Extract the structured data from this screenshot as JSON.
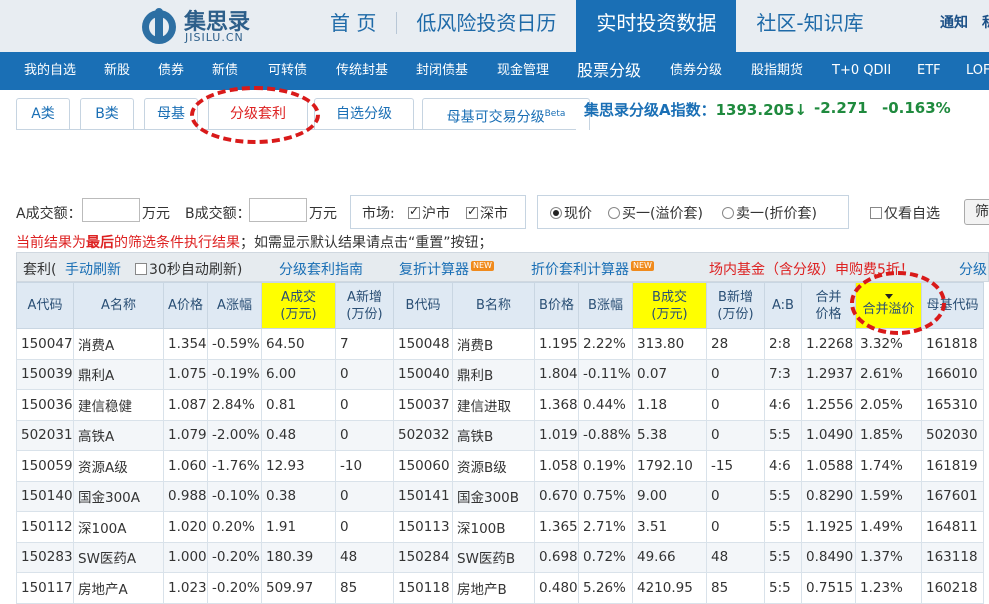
{
  "header": {
    "logo_cn": "集思录",
    "logo_en": "JISILU.CN",
    "nav": [
      {
        "label": "首 页",
        "active": false
      },
      {
        "label": "低风险投资日历",
        "active": false
      },
      {
        "label": "实时投资数据",
        "active": true
      },
      {
        "label": "社区-知识库",
        "active": false
      }
    ],
    "links": [
      "通知",
      "私"
    ]
  },
  "subnav": [
    "我的自选",
    "新股",
    "债券",
    "新债",
    "可转债",
    "传统封基",
    "封闭债基",
    "现金管理",
    "股票分级",
    "债券分级",
    "股指期货",
    "T+0 QDII",
    "ETF",
    "LOF"
  ],
  "tabs": [
    {
      "label": "A类"
    },
    {
      "label": "B类"
    },
    {
      "label": "母基"
    },
    {
      "label": "分级套利",
      "active": true
    },
    {
      "label": "自选分级"
    },
    {
      "label": "母基可交易分级",
      "sup": "Beta"
    }
  ],
  "index": {
    "label": "集思录分级A指数：",
    "value": "1393.205↓",
    "change": "-2.271",
    "pct": "-0.163%"
  },
  "filters": {
    "a_vol_label": "A成交额：",
    "a_unit": "万元",
    "b_vol_label": "B成交额：",
    "b_unit": "万元",
    "market_label": "市场:",
    "market_sh": "沪市",
    "market_sz": "深市",
    "price_now": "现价",
    "price_buy1": "买一(溢价套)",
    "price_sell1": "卖一(折价套)",
    "only_fav": "仅看自选",
    "filter_button": "筛"
  },
  "notice": {
    "part1": "当前结果为",
    "bold": "最后",
    "part2": "的筛选条件执行结果",
    "part3": "；如需显示默认结果请点击“重置”按钮；"
  },
  "band": {
    "title": "套利(",
    "manual": "手动刷新",
    "auto": "30秒自动刷新)",
    "guide": "分级套利指南",
    "calc1": "复折计算器",
    "calc2": "折价套利计算器",
    "new_tag": "NEW",
    "promo": "场内基金（含分级）申购费5折！",
    "more": "分级"
  },
  "columns": [
    "A代码",
    "A名称",
    "A价格",
    "A涨幅",
    "A成交\n(万元)",
    "A新增\n(万份)",
    "B代码",
    "B名称",
    "B价格",
    "B涨幅",
    "B成交\n(万元)",
    "B新增\n(万份)",
    "A:B",
    "合并\n价格",
    "合并溢价",
    "母基代码"
  ],
  "rows": [
    [
      "150047",
      "消费A",
      "1.354",
      "-0.59%",
      "64.50",
      "7",
      "150048",
      "消费B",
      "1.195",
      "2.22%",
      "313.80",
      "28",
      "2:8",
      "1.2268",
      "3.32%",
      "161818"
    ],
    [
      "150039",
      "鼎利A",
      "1.075",
      "-0.19%",
      "6.00",
      "0",
      "150040",
      "鼎利B",
      "1.804",
      "-0.11%",
      "0.07",
      "0",
      "7:3",
      "1.2937",
      "2.61%",
      "166010"
    ],
    [
      "150036",
      "建信稳健",
      "1.087",
      "2.84%",
      "0.81",
      "0",
      "150037",
      "建信进取",
      "1.368",
      "0.44%",
      "1.18",
      "0",
      "4:6",
      "1.2556",
      "2.05%",
      "165310"
    ],
    [
      "502031",
      "高铁A",
      "1.079",
      "-2.00%",
      "0.48",
      "0",
      "502032",
      "高铁B",
      "1.019",
      "-0.88%",
      "5.38",
      "0",
      "5:5",
      "1.0490",
      "1.85%",
      "502030"
    ],
    [
      "150059",
      "资源A级",
      "1.060",
      "-1.76%",
      "12.93",
      "-10",
      "150060",
      "资源B级",
      "1.058",
      "0.19%",
      "1792.10",
      "-15",
      "4:6",
      "1.0588",
      "1.74%",
      "161819"
    ],
    [
      "150140",
      "国金300A",
      "0.988",
      "-0.10%",
      "0.38",
      "0",
      "150141",
      "国金300B",
      "0.670",
      "0.75%",
      "9.00",
      "0",
      "5:5",
      "0.8290",
      "1.59%",
      "167601"
    ],
    [
      "150112",
      "深100A",
      "1.020",
      "0.20%",
      "1.91",
      "0",
      "150113",
      "深100B",
      "1.365",
      "2.71%",
      "3.51",
      "0",
      "5:5",
      "1.1925",
      "1.49%",
      "164811"
    ],
    [
      "150283",
      "SW医药A",
      "1.000",
      "-0.20%",
      "180.39",
      "48",
      "150284",
      "SW医药B",
      "0.698",
      "0.72%",
      "49.66",
      "48",
      "5:5",
      "0.8490",
      "1.37%",
      "163118"
    ],
    [
      "150117",
      "房地产A",
      "1.023",
      "-0.20%",
      "509.97",
      "85",
      "150118",
      "房地产B",
      "0.480",
      "5.26%",
      "4210.95",
      "85",
      "5:5",
      "0.7515",
      "1.23%",
      "160218"
    ]
  ],
  "colors": {
    "accent": "#1a6fb5",
    "up": "#d22222",
    "down": "#1f8a3e",
    "highlight": "#ffff00",
    "annotation": "#d91a1a"
  }
}
